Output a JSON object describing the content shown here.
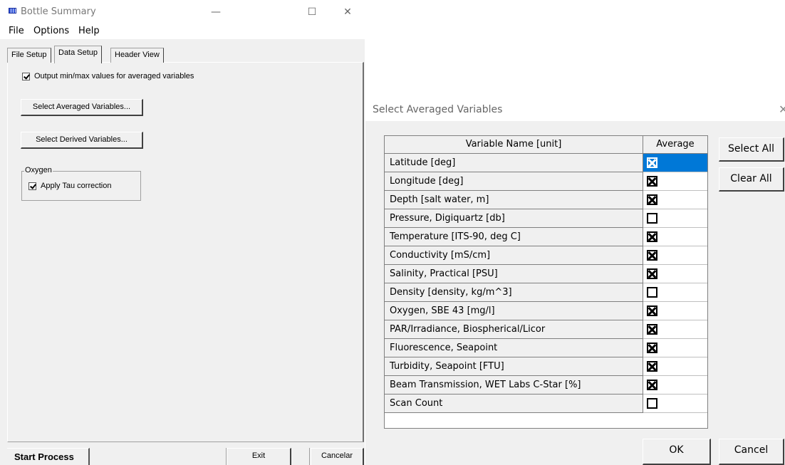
{
  "main_window": {
    "title": "Bottle Summary",
    "controls": {
      "minimize": "—",
      "maximize": "☐",
      "close": "✕"
    },
    "menu": [
      "File",
      "Options",
      "Help"
    ],
    "tabs": [
      "File Setup",
      "Data Setup",
      "Header View"
    ],
    "active_tab": "Data Setup",
    "output_minmax_label": "Output min/max values for averaged variables",
    "output_minmax_checked": true,
    "select_averaged_button": "Select Averaged Variables...",
    "select_derived_button": "Select Derived Variables...",
    "oxygen_group_label": "Oxygen",
    "tau_label": "Apply Tau correction",
    "tau_checked": true,
    "status": "Start Process",
    "exit_button": "Exit",
    "cancel_button": "Cancelar"
  },
  "dialog": {
    "title": "Select Averaged Variables",
    "close": "✕",
    "column_name": "Variable Name [unit]",
    "column_average": "Average",
    "rows": [
      {
        "name": "Latitude [deg]",
        "average": true
      },
      {
        "name": "Longitude [deg]",
        "average": true
      },
      {
        "name": "Depth [salt water, m]",
        "average": true
      },
      {
        "name": "Pressure, Digiquartz [db]",
        "average": false
      },
      {
        "name": "Temperature [ITS-90, deg C]",
        "average": true
      },
      {
        "name": "Conductivity [mS/cm]",
        "average": true
      },
      {
        "name": "Salinity, Practical [PSU]",
        "average": true
      },
      {
        "name": "Density [density, kg/m^3]",
        "average": false
      },
      {
        "name": "Oxygen, SBE 43 [mg/l]",
        "average": true
      },
      {
        "name": "PAR/Irradiance, Biospherical/Licor",
        "average": true
      },
      {
        "name": "Fluorescence, Seapoint",
        "average": true
      },
      {
        "name": "Turbidity, Seapoint [FTU]",
        "average": true
      },
      {
        "name": "Beam Transmission, WET Labs C-Star [%]",
        "average": true
      },
      {
        "name": "Scan Count",
        "average": false
      }
    ],
    "selected_row": 0,
    "select_all_button": "Select All",
    "clear_all_button": "Clear All",
    "ok_button": "OK",
    "cancel_button": "Cancel"
  }
}
